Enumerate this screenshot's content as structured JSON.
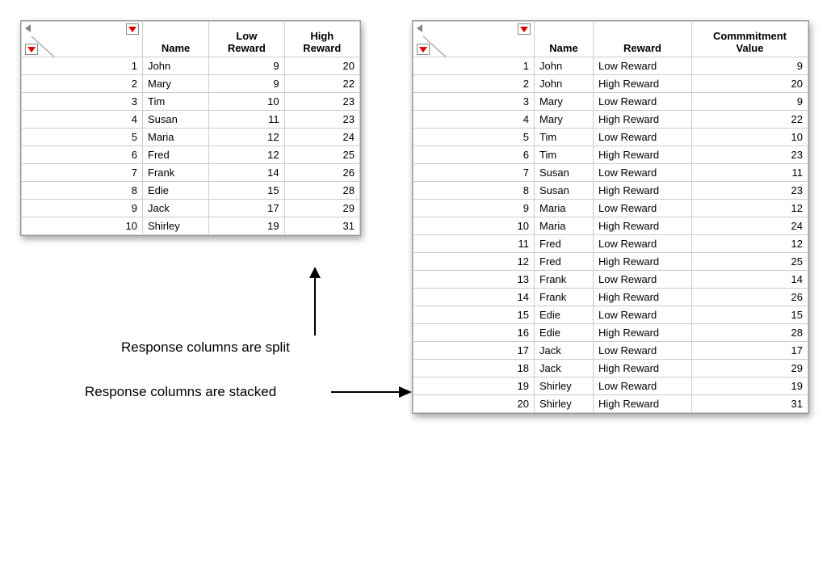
{
  "left": {
    "headers": {
      "c0": "",
      "c1": "Name",
      "c2": "Low\nReward",
      "c3": "High\nReward"
    },
    "rows": [
      {
        "n": "1",
        "name": "John",
        "low": "9",
        "high": "20"
      },
      {
        "n": "2",
        "name": "Mary",
        "low": "9",
        "high": "22"
      },
      {
        "n": "3",
        "name": "Tim",
        "low": "10",
        "high": "23"
      },
      {
        "n": "4",
        "name": "Susan",
        "low": "11",
        "high": "23"
      },
      {
        "n": "5",
        "name": "Maria",
        "low": "12",
        "high": "24"
      },
      {
        "n": "6",
        "name": "Fred",
        "low": "12",
        "high": "25"
      },
      {
        "n": "7",
        "name": "Frank",
        "low": "14",
        "high": "26"
      },
      {
        "n": "8",
        "name": "Edie",
        "low": "15",
        "high": "28"
      },
      {
        "n": "9",
        "name": "Jack",
        "low": "17",
        "high": "29"
      },
      {
        "n": "10",
        "name": "Shirley",
        "low": "19",
        "high": "31"
      }
    ]
  },
  "right": {
    "headers": {
      "c0": "",
      "c1": "Name",
      "c2": "Reward",
      "c3": "Commmitment\nValue"
    },
    "rows": [
      {
        "n": "1",
        "name": "John",
        "reward": "Low Reward",
        "val": "9"
      },
      {
        "n": "2",
        "name": "John",
        "reward": "High Reward",
        "val": "20"
      },
      {
        "n": "3",
        "name": "Mary",
        "reward": "Low Reward",
        "val": "9"
      },
      {
        "n": "4",
        "name": "Mary",
        "reward": "High Reward",
        "val": "22"
      },
      {
        "n": "5",
        "name": "Tim",
        "reward": "Low Reward",
        "val": "10"
      },
      {
        "n": "6",
        "name": "Tim",
        "reward": "High Reward",
        "val": "23"
      },
      {
        "n": "7",
        "name": "Susan",
        "reward": "Low Reward",
        "val": "11"
      },
      {
        "n": "8",
        "name": "Susan",
        "reward": "High Reward",
        "val": "23"
      },
      {
        "n": "9",
        "name": "Maria",
        "reward": "Low Reward",
        "val": "12"
      },
      {
        "n": "10",
        "name": "Maria",
        "reward": "High Reward",
        "val": "24"
      },
      {
        "n": "11",
        "name": "Fred",
        "reward": "Low Reward",
        "val": "12"
      },
      {
        "n": "12",
        "name": "Fred",
        "reward": "High Reward",
        "val": "25"
      },
      {
        "n": "13",
        "name": "Frank",
        "reward": "Low Reward",
        "val": "14"
      },
      {
        "n": "14",
        "name": "Frank",
        "reward": "High Reward",
        "val": "26"
      },
      {
        "n": "15",
        "name": "Edie",
        "reward": "Low Reward",
        "val": "15"
      },
      {
        "n": "16",
        "name": "Edie",
        "reward": "High Reward",
        "val": "28"
      },
      {
        "n": "17",
        "name": "Jack",
        "reward": "Low Reward",
        "val": "17"
      },
      {
        "n": "18",
        "name": "Jack",
        "reward": "High Reward",
        "val": "29"
      },
      {
        "n": "19",
        "name": "Shirley",
        "reward": "Low Reward",
        "val": "19"
      },
      {
        "n": "20",
        "name": "Shirley",
        "reward": "High Reward",
        "val": "31"
      }
    ]
  },
  "captions": {
    "split": "Response columns are split",
    "stacked": "Response columns are stacked"
  }
}
